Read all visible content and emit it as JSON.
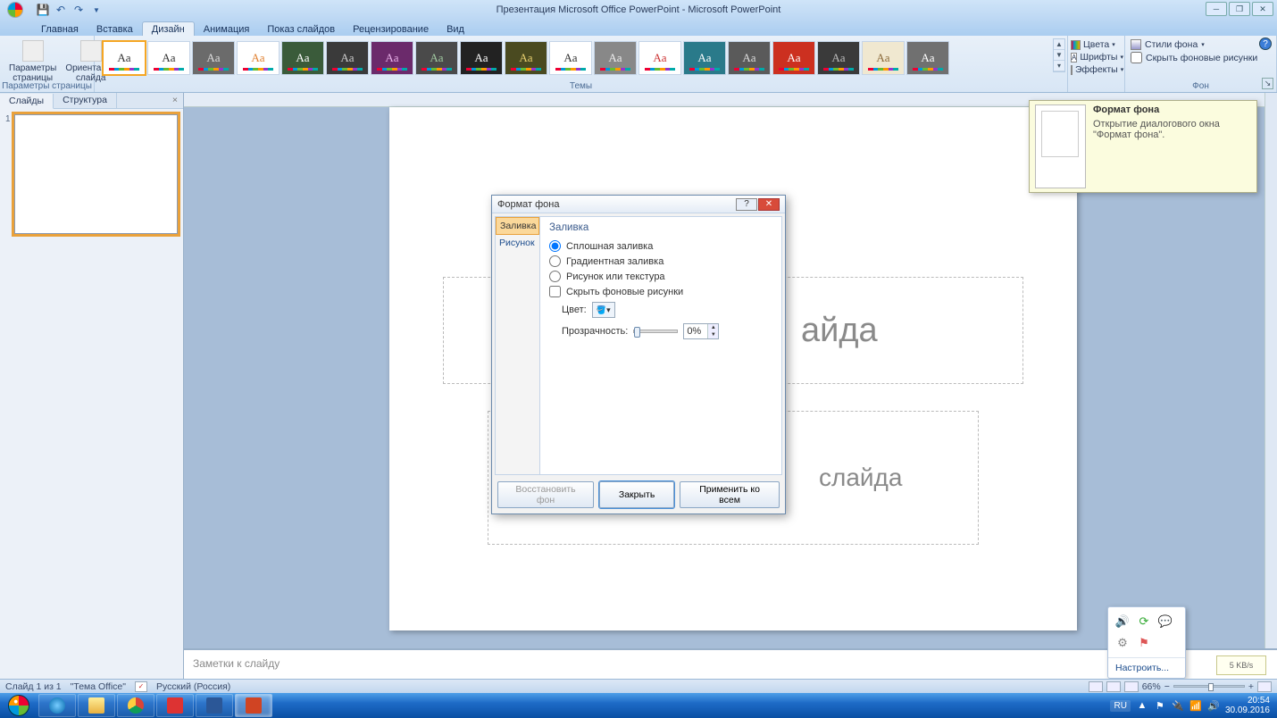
{
  "title": "Презентация Microsoft Office PowerPoint - Microsoft PowerPoint",
  "ribbon_tabs": [
    "Главная",
    "Вставка",
    "Дизайн",
    "Анимация",
    "Показ слайдов",
    "Рецензирование",
    "Вид"
  ],
  "ribbon_active": 2,
  "groups": {
    "page_params": {
      "label": "Параметры страницы",
      "btn1": "Параметры\nстраницы",
      "btn2": "Ориентация\nслайда"
    },
    "themes_label": "Темы",
    "theme_opts": {
      "colors": "Цвета",
      "fonts": "Шрифты",
      "effects": "Эффекты"
    },
    "bg": {
      "label": "Фон",
      "styles": "Стили фона",
      "hide": "Скрыть фоновые рисунки"
    }
  },
  "theme_thumbs": [
    {
      "bg": "#ffffff",
      "fg": "#333333"
    },
    {
      "bg": "#ffffff",
      "fg": "#333333"
    },
    {
      "bg": "#6b6b6b",
      "fg": "#dddddd"
    },
    {
      "bg": "#ffffff",
      "fg": "#e08030"
    },
    {
      "bg": "#3a5b3a",
      "fg": "#ffffff"
    },
    {
      "bg": "#3a3a3a",
      "fg": "#cccccc"
    },
    {
      "bg": "#6b2a6b",
      "fg": "#e8b0e8"
    },
    {
      "bg": "#4a4a4a",
      "fg": "#a0c8a0"
    },
    {
      "bg": "#222222",
      "fg": "#ffffff"
    },
    {
      "bg": "#4a4a20",
      "fg": "#e8d070"
    },
    {
      "bg": "#ffffff",
      "fg": "#333333"
    },
    {
      "bg": "#888888",
      "fg": "#eeeeee"
    },
    {
      "bg": "#ffffff",
      "fg": "#cc3333"
    },
    {
      "bg": "#2a7a8a",
      "fg": "#ffffff"
    },
    {
      "bg": "#5a5a5a",
      "fg": "#dddddd"
    },
    {
      "bg": "#cc3020",
      "fg": "#ffffff"
    },
    {
      "bg": "#3a3a3a",
      "fg": "#bbbbbb"
    },
    {
      "bg": "#f0e8d0",
      "fg": "#8a6a3a"
    },
    {
      "bg": "#707070",
      "fg": "#ffffff"
    }
  ],
  "left_pane": {
    "tab1": "Слайды",
    "tab2": "Структура",
    "slide_num": "1"
  },
  "slide": {
    "title_ph": "айда",
    "sub_ph": "слайда"
  },
  "notes_placeholder": "Заметки к слайду",
  "tooltip": {
    "head": "Формат фона",
    "body": "Открытие диалогового окна \"Формат фона\"."
  },
  "dialog": {
    "title": "Формат фона",
    "side": {
      "tab1": "Заливка",
      "tab2": "Рисунок"
    },
    "heading": "Заливка",
    "opts": {
      "solid": "Сплошная заливка",
      "grad": "Градиентная заливка",
      "pic": "Рисунок или текстура",
      "hide": "Скрыть фоновые рисунки"
    },
    "color_lbl": "Цвет:",
    "trans_lbl": "Прозрачность:",
    "trans_val": "0%",
    "btns": {
      "reset": "Восстановить фон",
      "close": "Закрыть",
      "apply": "Применить ко всем"
    }
  },
  "status": {
    "slide": "Слайд 1 из 1",
    "theme": "\"Тема Office\"",
    "lang": "Русский (Россия)",
    "zoom": "66%"
  },
  "sys_pop_link": "Настроить...",
  "net_pop": "5 KB/s",
  "tray": {
    "lang": "RU",
    "time": "20:54",
    "date": "30.09.2016"
  }
}
